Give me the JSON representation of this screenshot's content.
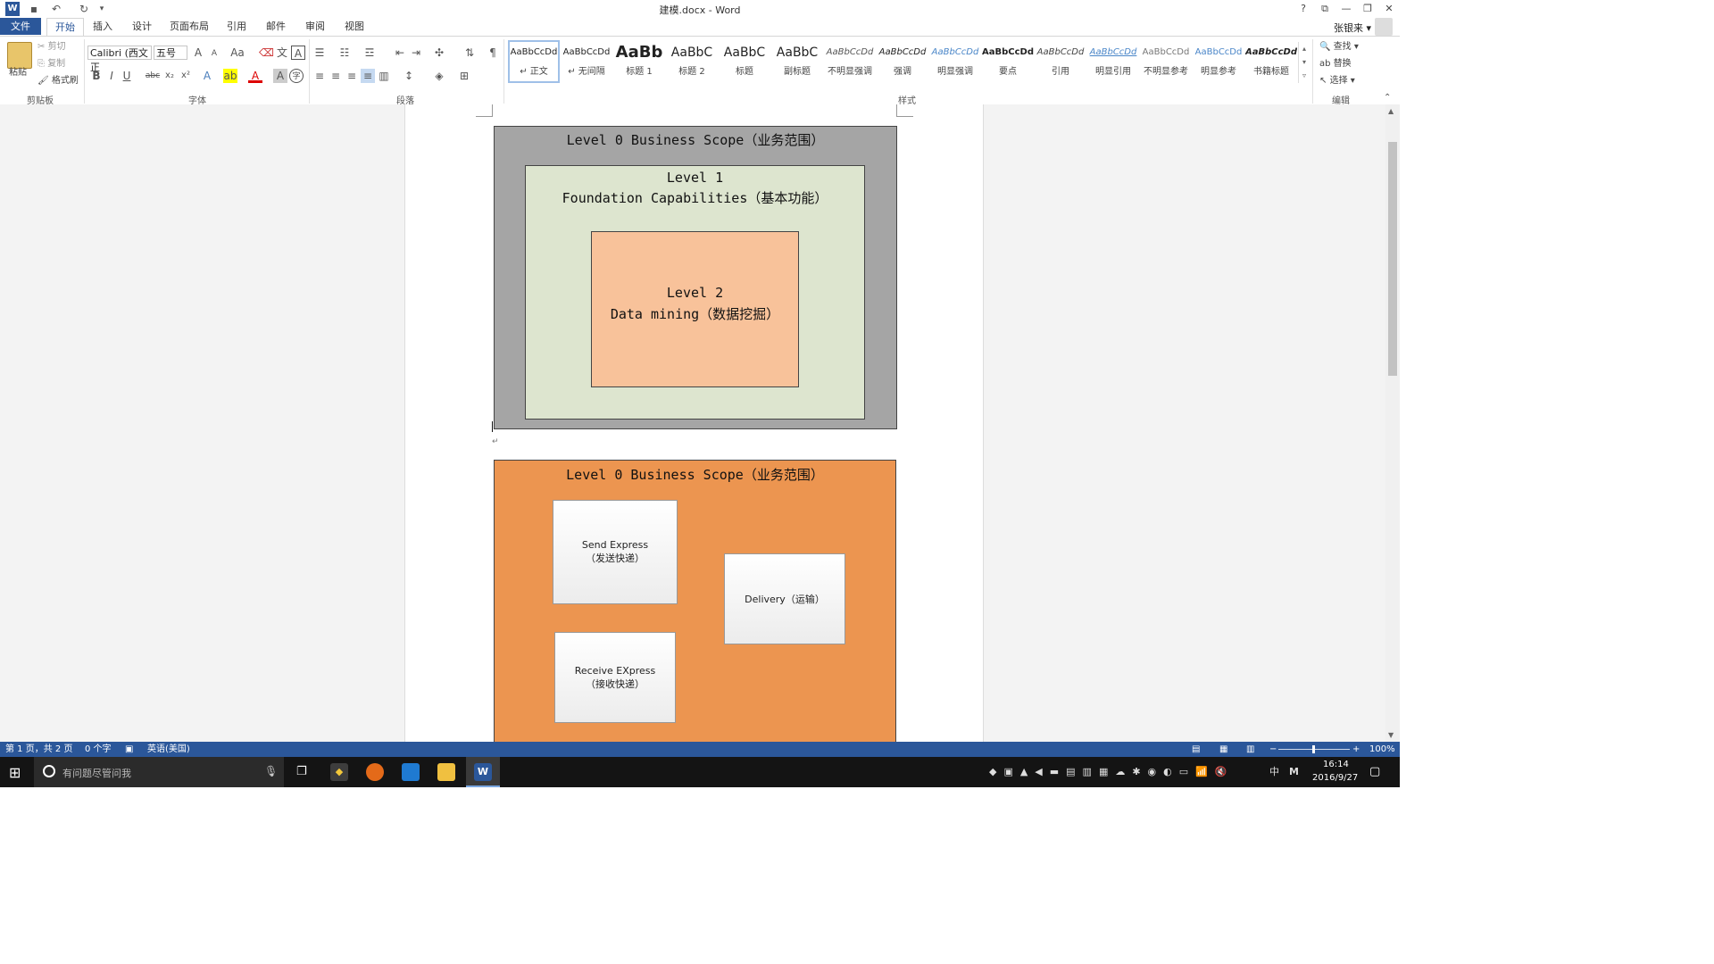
{
  "window": {
    "title": "建模.docx - Word",
    "user": "张银来 ▾"
  },
  "qat": {
    "word_icon": "word-icon",
    "save": "save-icon",
    "undo": "undo-icon",
    "redo": "redo-icon",
    "customize": "customize-icon"
  },
  "window_controls": {
    "help": "?",
    "ribbon_display": "⧉",
    "minimize": "—",
    "restore": "❐",
    "close": "✕"
  },
  "tabs": [
    {
      "label": "文件"
    },
    {
      "label": "开始"
    },
    {
      "label": "插入"
    },
    {
      "label": "设计"
    },
    {
      "label": "页面布局"
    },
    {
      "label": "引用"
    },
    {
      "label": "邮件"
    },
    {
      "label": "审阅"
    },
    {
      "label": "视图"
    }
  ],
  "clipboard": {
    "paste": "粘贴",
    "cut": "剪切",
    "copy": "复制",
    "format_painter": "格式刷",
    "group": "剪贴板"
  },
  "font": {
    "name": "Calibri (西文正",
    "size": "五号",
    "group": "字体",
    "bold": "B",
    "italic": "I",
    "underline": "U",
    "strike": "abc",
    "sub": "x₂",
    "sup": "x²",
    "grow": "A",
    "shrink": "A",
    "case": "Aa",
    "text_effects": "A",
    "highlight": "ab",
    "font_color": "A",
    "char_shading": "A",
    "enclose": "字"
  },
  "paragraph": {
    "group": "段落"
  },
  "styles": {
    "group": "样式",
    "items": [
      {
        "preview": "AaBbCcDd",
        "name": "↵ 正文"
      },
      {
        "preview": "AaBbCcDd",
        "name": "↵ 无间隔"
      },
      {
        "preview": "AaBb",
        "name": "标题 1"
      },
      {
        "preview": "AaBbC",
        "name": "标题 2"
      },
      {
        "preview": "AaBbC",
        "name": "标题"
      },
      {
        "preview": "AaBbC",
        "name": "副标题"
      },
      {
        "preview": "AaBbCcDd",
        "name": "不明显强调"
      },
      {
        "preview": "AaBbCcDd",
        "name": "强调"
      },
      {
        "preview": "AaBbCcDd",
        "name": "明显强调"
      },
      {
        "preview": "AaBbCcDd",
        "name": "要点"
      },
      {
        "preview": "AaBbCcDd",
        "name": "引用"
      },
      {
        "preview": "AaBbCcDd",
        "name": "明显引用"
      },
      {
        "preview": "AaBbCcDd",
        "name": "不明显参考"
      },
      {
        "preview": "AaBbCcDd",
        "name": "明显参考"
      },
      {
        "preview": "AaBbCcDd",
        "name": "书籍标题"
      }
    ]
  },
  "editing": {
    "find": "查找",
    "replace": "替换",
    "select": "选择",
    "group": "编辑"
  },
  "diagram1": {
    "level0": "Level 0 Business Scope（业务范围）",
    "level1_a": "Level 1",
    "level1_b": "Foundation Capabilities（基本功能）",
    "level2_a": "Level 2",
    "level2_b": "Data mining（数据挖掘）",
    "colors": {
      "outer": "#a5a5a5",
      "middle": "#dde5cf",
      "inner": "#f8c29a"
    }
  },
  "paragraph_mark": "↵",
  "diagram2": {
    "title": "Level 0 Business Scope（业务范围）",
    "send_a": "Send Express",
    "send_b": "（发送快递）",
    "receive_a": "Receive EXpress",
    "receive_b": "（接收快递）",
    "delivery": "Delivery（运输）",
    "colors": {
      "bg": "#ec9550"
    }
  },
  "status": {
    "page": "第 1 页，共 2 页",
    "words": "0 个字",
    "language": "英语(美国)",
    "zoom": "100%"
  },
  "taskbar": {
    "search_placeholder": "有问题尽管问我",
    "time": "16:14",
    "date": "2016/9/27",
    "ime": "中",
    "ime2": "M"
  }
}
